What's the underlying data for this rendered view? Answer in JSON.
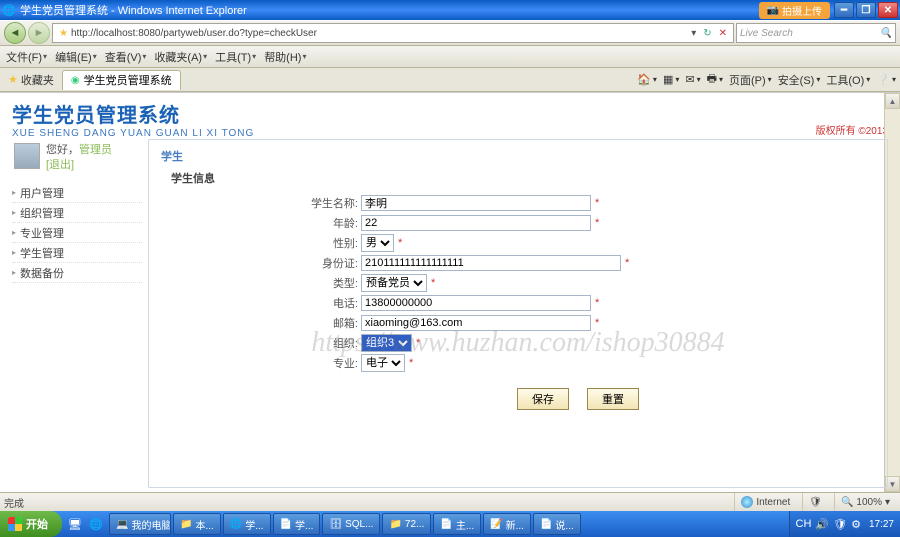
{
  "window": {
    "title": "学生党员管理系统 - Windows Internet Explorer",
    "upload_badge": "拍摄上传"
  },
  "addressbar": {
    "url": "http://localhost:8080/partyweb/user.do?type=checkUser",
    "refresh_label": "刷新",
    "search_placeholder": "Live Search"
  },
  "ie_menu": {
    "file": "文件(F)",
    "edit": "编辑(E)",
    "view": "查看(V)",
    "favorites": "收藏夹(A)",
    "tools": "工具(T)",
    "help": "帮助(H)"
  },
  "tabbar": {
    "fav_label": "收藏夹",
    "tab_title": "学生党员管理系统",
    "tools": {
      "home": "",
      "page": "页面(P)",
      "safety": "安全(S)",
      "tools_menu": "工具(O)"
    }
  },
  "app": {
    "title_cn": "学生党员管理系统",
    "title_en": "XUE SHENG DANG YUAN GUAN LI XI TONG",
    "copyright": "版权所有  ©2013"
  },
  "user_panel": {
    "greeting": "您好，",
    "role": "管理员",
    "logout": "[退出]"
  },
  "nav": {
    "items": [
      {
        "label": "用户管理"
      },
      {
        "label": "组织管理"
      },
      {
        "label": "专业管理"
      },
      {
        "label": "学生管理"
      },
      {
        "label": "数据备份"
      }
    ]
  },
  "breadcrumb": "学生",
  "form": {
    "section_title": "学生信息",
    "labels": {
      "name": "学生名称:",
      "age": "年龄:",
      "gender": "性别:",
      "idcard": "身份证:",
      "type": "类型:",
      "phone": "电话:",
      "email": "邮箱:",
      "org": "组织:",
      "major": "专业:"
    },
    "values": {
      "name": "李明",
      "age": "22",
      "gender": "男",
      "idcard": "210111111111111111",
      "type": "预备党员",
      "phone": "13800000000",
      "email": "xiaoming@163.com",
      "org": "组织3",
      "major": "电子"
    },
    "buttons": {
      "save": "保存",
      "reset": "重置"
    },
    "asterisk": "*"
  },
  "watermark": "https://www.huzhan.com/ishop30884",
  "statusbar": {
    "done": "完成",
    "zone": "Internet",
    "zoom": "100%"
  },
  "taskbar": {
    "start": "开始",
    "items": [
      {
        "label": "我的电脑"
      },
      {
        "label": "本..."
      },
      {
        "label": "学..."
      },
      {
        "label": "学..."
      },
      {
        "label": "SQL..."
      },
      {
        "label": "72..."
      },
      {
        "label": "主..."
      },
      {
        "label": "新..."
      },
      {
        "label": "说..."
      }
    ],
    "clock": "17:27"
  }
}
